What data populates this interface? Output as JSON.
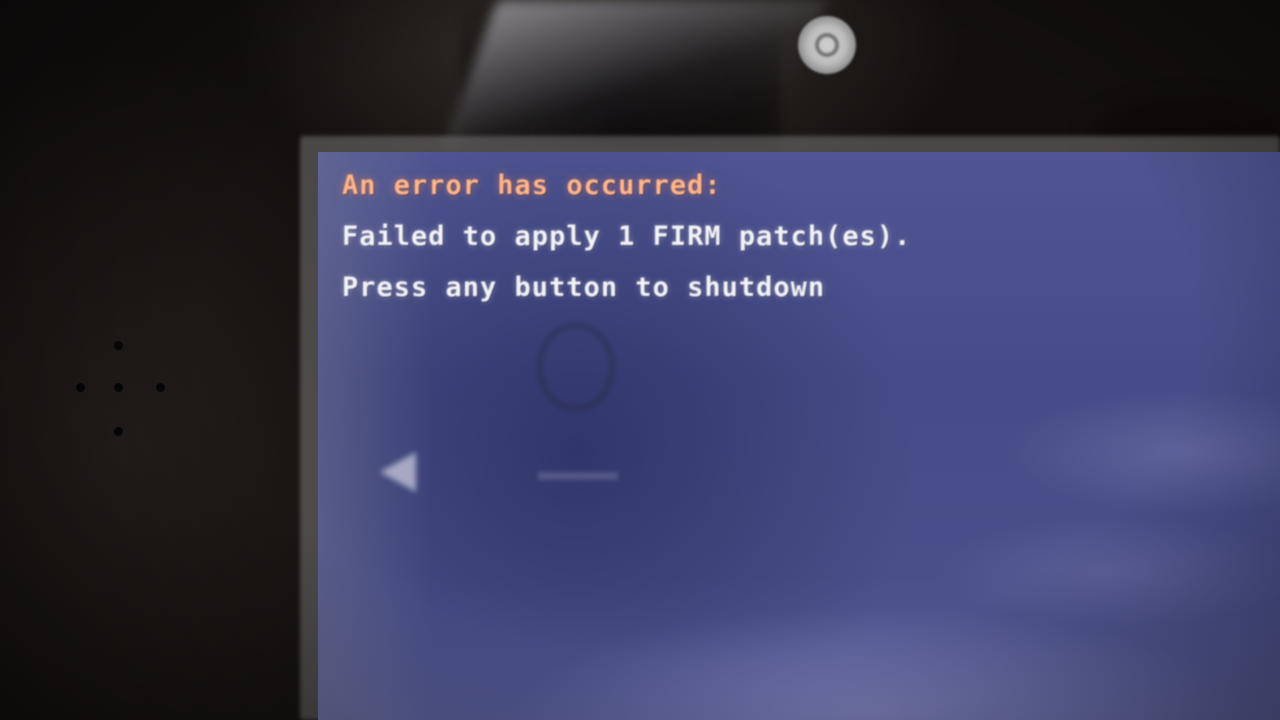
{
  "error_screen": {
    "title": "An error has occurred:",
    "message": "Failed to apply 1 FIRM patch(es).",
    "instruction": "Press any button to shutdown"
  },
  "colors": {
    "screen_background": "#4a4f8a",
    "title_text": "#ffb58a",
    "body_text": "#f2f2f8",
    "device_bezel": "#1f1a17"
  },
  "icons": {
    "front_camera": "camera-lens",
    "speaker": "speaker-grille"
  }
}
